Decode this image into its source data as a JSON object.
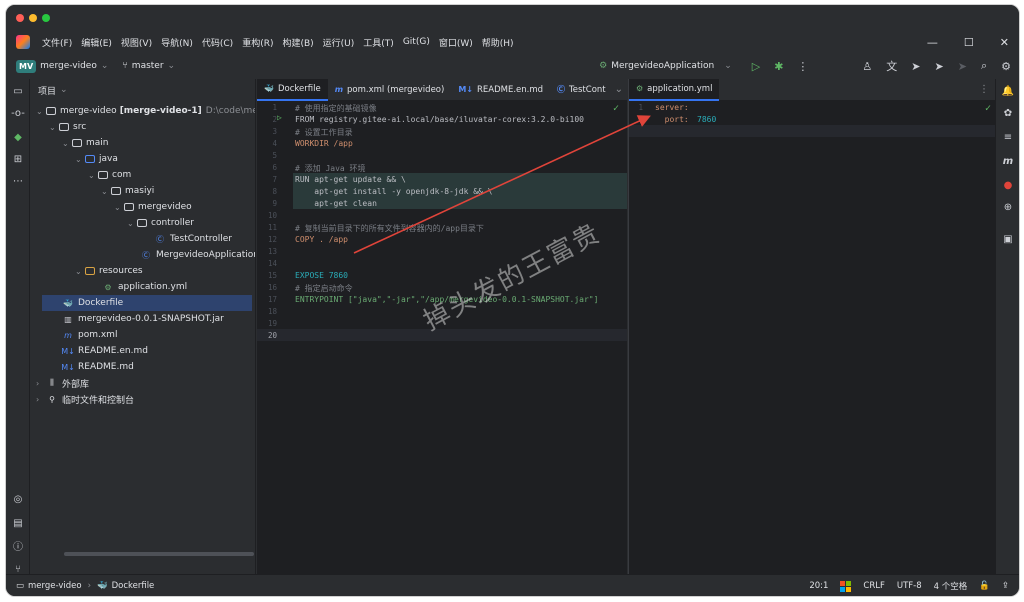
{
  "menubar": {
    "items": [
      "文件(F)",
      "编辑(E)",
      "视图(V)",
      "导航(N)",
      "代码(C)",
      "重构(R)",
      "构建(B)",
      "运行(U)",
      "工具(T)",
      "Git(G)",
      "窗口(W)",
      "帮助(H)"
    ]
  },
  "toolbar": {
    "project_badge": "MV",
    "project_name": "merge-video",
    "branch": "master",
    "run_config": "MergevideoApplication"
  },
  "project_panel": {
    "header": "项目",
    "root": "merge-video",
    "root_module": "[merge-video-1]",
    "root_path": "D:\\code\\merg",
    "nodes": {
      "src": "src",
      "main": "main",
      "java": "java",
      "com": "com",
      "masiyi": "masiyi",
      "mergevideo": "mergevideo",
      "controller": "controller",
      "test_controller": "TestController",
      "app_class": "MergevideoApplication",
      "resources": "resources",
      "application_yml": "application.yml",
      "dockerfile": "Dockerfile",
      "jar": "mergevideo-0.0.1-SNAPSHOT.jar",
      "pom": "pom.xml",
      "readme_en": "README.en.md",
      "readme": "README.md",
      "external_libs": "外部库",
      "scratches": "临时文件和控制台"
    }
  },
  "editor_left": {
    "tabs": [
      {
        "icon": "docker-icon",
        "label": "Dockerfile",
        "active": true
      },
      {
        "icon": "maven-icon",
        "label": "pom.xml (mergevideo)",
        "active": false
      },
      {
        "icon": "markdown-icon",
        "label": "README.en.md",
        "active": false
      },
      {
        "icon": "class-icon",
        "label": "TestCont",
        "active": false
      }
    ],
    "lines": [
      {
        "n": "1",
        "text": "# 使用指定的基础镜像"
      },
      {
        "n": "2",
        "text": "FROM registry.gitee-ai.local/base/iluvatar-corex:3.2.0-bi100"
      },
      {
        "n": "3",
        "text": "# 设置工作目录"
      },
      {
        "n": "4",
        "text": "WORKDIR /app"
      },
      {
        "n": "5",
        "text": ""
      },
      {
        "n": "6",
        "text": "# 添加 Java 环境"
      },
      {
        "n": "7",
        "text": "RUN apt-get update && \\"
      },
      {
        "n": "8",
        "text": "    apt-get install -y openjdk-8-jdk && \\"
      },
      {
        "n": "9",
        "text": "    apt-get clean"
      },
      {
        "n": "10",
        "text": ""
      },
      {
        "n": "11",
        "text": "# 复制当前目录下的所有文件到容器内的/app目录下"
      },
      {
        "n": "12",
        "text": "COPY . /app"
      },
      {
        "n": "13",
        "text": ""
      },
      {
        "n": "14",
        "text": ""
      },
      {
        "n": "15",
        "text": "EXPOSE 7860"
      },
      {
        "n": "16",
        "text": "# 指定启动命令"
      },
      {
        "n": "17",
        "text": "ENTRYPOINT [\"java\",\"-jar\",\"/app/mergevideo-0.0.1-SNAPSHOT.jar\"]"
      },
      {
        "n": "18",
        "text": ""
      },
      {
        "n": "19",
        "text": ""
      },
      {
        "n": "20",
        "text": ""
      }
    ]
  },
  "editor_right": {
    "tab": "application.yml",
    "lines": [
      {
        "n": "1",
        "key": "server:",
        "value": ""
      },
      {
        "n": "2",
        "key": "  port: ",
        "value": "7860"
      }
    ]
  },
  "statusbar": {
    "project": "merge-video",
    "file": "Dockerfile",
    "position": "20:1",
    "line_sep": "CRLF",
    "encoding": "UTF-8",
    "indent": "4 个空格"
  },
  "watermark": "掉头发的王富贵",
  "colors": {
    "accent": "#3574f0",
    "keyword": "#cf8e6d",
    "number": "#2aacb8",
    "arrow": "#e0443a"
  }
}
